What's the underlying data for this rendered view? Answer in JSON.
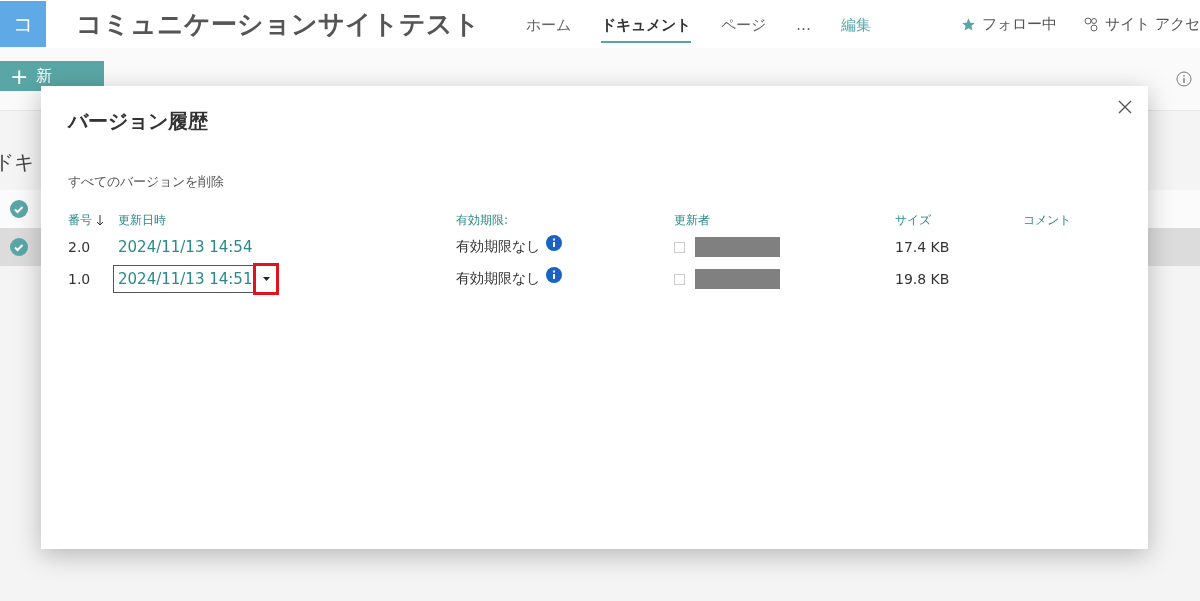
{
  "site": {
    "logo_letter": "コ",
    "title": "コミュニケーションサイトテスト",
    "nav": [
      {
        "label": "ホーム",
        "selected": false,
        "kind": "link"
      },
      {
        "label": "ドキュメント",
        "selected": true,
        "kind": "link"
      },
      {
        "label": "ページ",
        "selected": false,
        "kind": "link"
      },
      {
        "label": "…",
        "selected": false,
        "kind": "link"
      },
      {
        "label": "編集",
        "selected": false,
        "kind": "edit"
      }
    ],
    "follow": "フォロー中",
    "site_access": "サイト アクセ"
  },
  "toolbar": {
    "new_icon": "+",
    "new_button": "新"
  },
  "library": {
    "title": "ドキ",
    "rows": [
      {
        "selected": false
      },
      {
        "selected": true
      }
    ]
  },
  "dialog": {
    "title": "バージョン履歴",
    "delete_all": "すべてのバージョンを削除",
    "columns": [
      "番号",
      "更新日時",
      "有効期限:",
      "更新者",
      "サイズ",
      "コメント"
    ],
    "rows": [
      {
        "number": "2.0",
        "modified": "2024/11/13 14:54",
        "expiry": "有効期限なし",
        "size": "17.4 KB",
        "checked": false,
        "selected": false
      },
      {
        "number": "1.0",
        "modified": "2024/11/13 14:51",
        "expiry": "有効期限なし",
        "size": "19.8 KB",
        "checked": false,
        "selected": true
      }
    ]
  }
}
